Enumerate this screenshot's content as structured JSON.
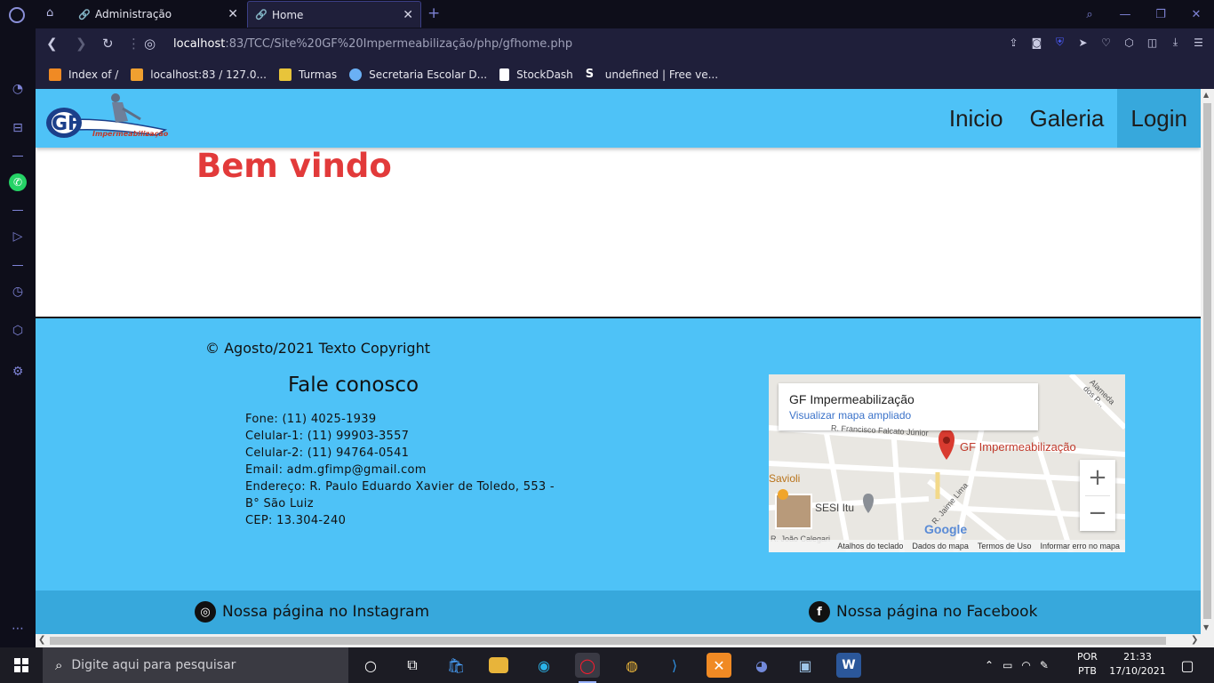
{
  "browser": {
    "tabs": [
      {
        "title": "Administração",
        "active": false
      },
      {
        "title": "Home",
        "active": true
      }
    ],
    "address": {
      "host": "localhost",
      "rest": ":83/TCC/Site%20GF%20Impermeabilização/php/gfhome.php"
    },
    "bookmarks": [
      {
        "label": "Index of /",
        "color": "#f08a24"
      },
      {
        "label": "localhost:83 / 127.0...",
        "color": "#f0a030"
      },
      {
        "label": "Turmas",
        "color": "#e8c43a"
      },
      {
        "label": "Secretaria Escolar D...",
        "color": "#6ab0f5"
      },
      {
        "label": "StockDash",
        "color": "#ffffff"
      },
      {
        "label": "undefined | Free ve...",
        "color": "#ffffff"
      }
    ]
  },
  "site": {
    "logo_text": "GF",
    "logo_subtext": "Impermeabilização",
    "nav": [
      "Inicio",
      "Galeria",
      "Login"
    ],
    "welcome": "Bem vindo",
    "copyright": "© Agosto/2021 Texto Copyright",
    "contact_title": "Fale conosco",
    "contact": {
      "phone": "Fone: (11) 4025-1939",
      "cell1": "Celular-1: (11) 99903-3557",
      "cell2": "Celular-2: (11) 94764-0541",
      "email": "Email: adm.gfimp@gmail.com",
      "address": "Endereço: R. Paulo Eduardo Xavier de Toledo, 553 - B° São Luiz",
      "cep": "CEP: 13.304-240"
    },
    "map": {
      "place": "GF Impermeabilização",
      "link": "Visualizar mapa ampliado",
      "pin_label": "GF Impermeabilização",
      "poi1": "Savioli",
      "poi2": "SESI Itu",
      "street1": "R. Francisco Falcato Júnior",
      "street2": "R. Jaime Lima",
      "street3": "R. João Calegari",
      "street4": "Alameda dos P...",
      "google": "Google",
      "footer": [
        "Atalhos do teclado",
        "Dados do mapa",
        "Termos de Uso",
        "Informar erro no mapa"
      ]
    },
    "instagram": "Nossa página no Instagram",
    "facebook": "Nossa página no Facebook"
  },
  "taskbar": {
    "search_placeholder": "Digite aqui para pesquisar",
    "lang_1": "POR",
    "lang_2": "PTB",
    "time": "21:33",
    "date": "17/10/2021"
  }
}
